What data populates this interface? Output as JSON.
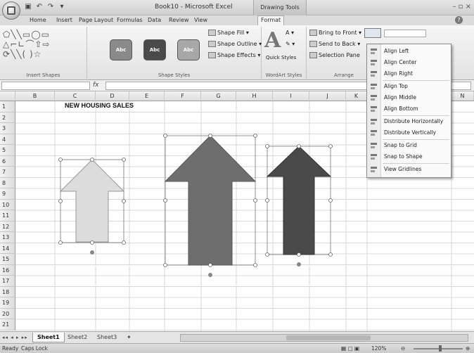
{
  "window": {
    "title": "Book10 - Microsoft Excel",
    "context_tab_header": "Drawing Tools"
  },
  "tabs": [
    {
      "label": "Home"
    },
    {
      "label": "Insert"
    },
    {
      "label": "Page Layout"
    },
    {
      "label": "Formulas"
    },
    {
      "label": "Data"
    },
    {
      "label": "Review"
    },
    {
      "label": "View"
    },
    {
      "label": "Format"
    }
  ],
  "active_tab": "Format",
  "ribbon": {
    "insert_shapes_label": "Insert Shapes",
    "shape_styles_label": "Shape Styles",
    "style_buttons": [
      "Abc",
      "Abc",
      "Abc"
    ],
    "shape_fill": "Shape Fill",
    "shape_outline": "Shape Outline",
    "shape_effects": "Shape Effects",
    "quick_styles": "Quick Styles",
    "wordart_label": "WordArt Styles",
    "bring_to_front": "Bring to Front",
    "send_to_back": "Send to Back",
    "selection_pane": "Selection Pane",
    "arrange_label": "Arrange"
  },
  "formula_bar": {
    "fx": "fx"
  },
  "columns": [
    "B",
    "C",
    "D",
    "E",
    "F",
    "G",
    "H",
    "I",
    "J",
    "K",
    "N"
  ],
  "rows": [
    "1",
    "2",
    "3",
    "4",
    "5",
    "6",
    "7",
    "8",
    "9",
    "10",
    "11",
    "12",
    "13",
    "14",
    "15",
    "16",
    "17",
    "18",
    "19",
    "20",
    "21"
  ],
  "cell_title": "NEW HOUSING SALES",
  "align_menu": {
    "items": [
      {
        "label": "Align Left",
        "icon": "align-left-icon"
      },
      {
        "label": "Align Center",
        "icon": "align-center-icon"
      },
      {
        "label": "Align Right",
        "icon": "align-right-icon"
      },
      {
        "label": "Align Top",
        "icon": "align-top-icon"
      },
      {
        "label": "Align Middle",
        "icon": "align-middle-icon"
      },
      {
        "label": "Align Bottom",
        "icon": "align-bottom-icon"
      },
      {
        "label": "Distribute Horizontally",
        "icon": "distribute-horizontally-icon"
      },
      {
        "label": "Distribute Vertically",
        "icon": "distribute-vertically-icon"
      },
      {
        "label": "Snap to Grid",
        "icon": "snap-to-grid-icon"
      },
      {
        "label": "Snap to Shape",
        "icon": "snap-to-shape-icon"
      },
      {
        "label": "View Gridlines",
        "icon": "view-gridlines-icon"
      }
    ]
  },
  "sheets": [
    {
      "label": "Sheet1"
    },
    {
      "label": "Sheet2"
    },
    {
      "label": "Sheet3"
    }
  ],
  "status": {
    "ready": "Ready",
    "caps_lock": "Caps Lock",
    "zoom": "120%"
  },
  "colors": {
    "arrow_light": "#dcdcdc",
    "arrow_medium": "#6e6e6e",
    "arrow_dark": "#4a4a4a",
    "style_btn_1": "#8a8a8a",
    "style_btn_2": "#4a4a4a",
    "style_btn_3": "#a8a8a8"
  }
}
